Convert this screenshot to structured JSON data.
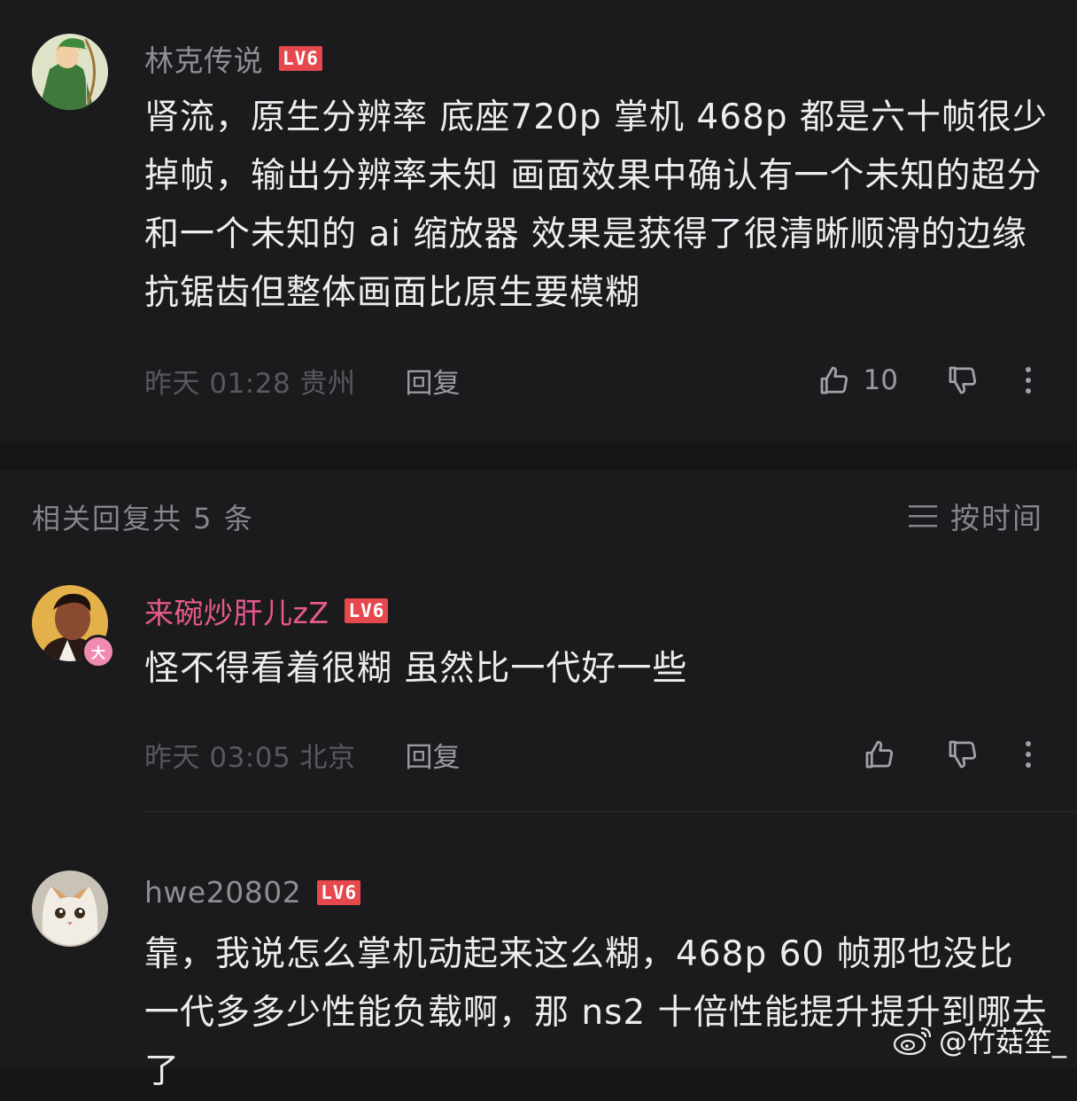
{
  "main_comment": {
    "username": "林克传说",
    "level": "LV6",
    "text": "肾流，原生分辨率 底座720p 掌机 468p 都是六十帧很少掉帧，输出分辨率未知 画面效果中确认有一个未知的超分 和一个未知的 ai 缩放器 效果是获得了很清晰顺滑的边缘抗锯齿但整体画面比原生要模糊",
    "time_location": "昨天 01:28 贵州",
    "reply_label": "回复",
    "like_count": "10",
    "avatar_icon": "anime-archer-avatar"
  },
  "replies_section": {
    "header": "相关回复共 5 条",
    "sort_label": "按时间",
    "sort_icon": "menu-icon"
  },
  "replies": [
    {
      "username": "来碗炒肝儿zZ",
      "level": "LV6",
      "badge": "大",
      "text": "怪不得看着很糊 虽然比一代好一些",
      "time_location": "昨天 03:05 北京",
      "reply_label": "回复",
      "avatar_icon": "portrait-avatar"
    },
    {
      "username": "hwe20802",
      "level": "LV6",
      "text": "靠，我说怎么掌机动起来这么糊，468p 60 帧那也没比一代多多少性能负载啊，那 ns2 十倍性能提升提升到哪去了",
      "avatar_icon": "cat-avatar"
    }
  ],
  "watermark": {
    "text": "@竹菇笙_",
    "icon": "weibo-logo-icon"
  },
  "colors": {
    "background": "#161618",
    "card": "#1b1b1d",
    "level_badge": "#e5484d",
    "pink_username": "#e65a8c"
  }
}
